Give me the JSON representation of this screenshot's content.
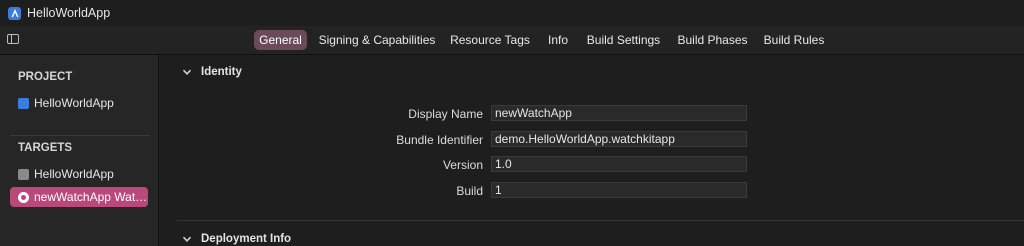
{
  "window": {
    "title": "HelloWorldApp"
  },
  "tabs": [
    {
      "label": "General",
      "active": true
    },
    {
      "label": "Signing & Capabilities",
      "active": false
    },
    {
      "label": "Resource Tags",
      "active": false
    },
    {
      "label": "Info",
      "active": false
    },
    {
      "label": "Build Settings",
      "active": false
    },
    {
      "label": "Build Phases",
      "active": false
    },
    {
      "label": "Build Rules",
      "active": false
    }
  ],
  "sidebar": {
    "project_heading": "PROJECT",
    "project_item": "HelloWorldApp",
    "targets_heading": "TARGETS",
    "target_items": [
      {
        "label": "HelloWorldApp",
        "selected": false
      },
      {
        "label": "newWatchApp Watc...",
        "selected": true
      }
    ]
  },
  "identity": {
    "heading": "Identity",
    "fields": {
      "display_name": {
        "label": "Display Name",
        "value": "newWatchApp"
      },
      "bundle_identifier": {
        "label": "Bundle Identifier",
        "value": "demo.HelloWorldApp.watchkitapp"
      },
      "version": {
        "label": "Version",
        "value": "1.0"
      },
      "build": {
        "label": "Build",
        "value": "1"
      }
    }
  },
  "deployment": {
    "heading": "Deployment Info"
  },
  "colors": {
    "active_tab": "#6b4b58",
    "selected_target": "#b8497a",
    "app_icon": "#3b7ddd"
  }
}
